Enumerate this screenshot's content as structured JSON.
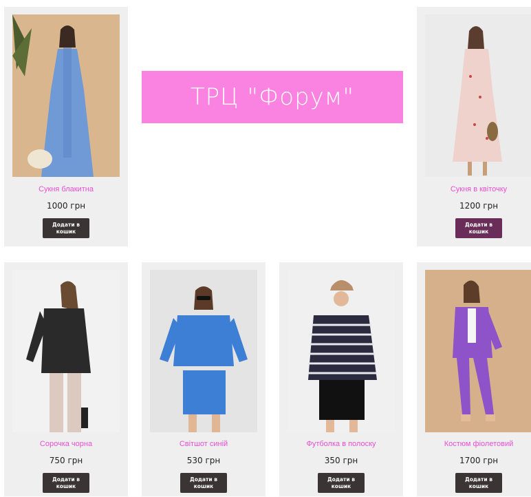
{
  "banner": {
    "text": "ТРЦ \"Форум\""
  },
  "colors": {
    "accent": "#fa82e0",
    "product_name": "#e64fd3",
    "button": "#3b3434",
    "button_active": "#6a2c58"
  },
  "products": [
    {
      "name": "Сукня блакитна",
      "price": "1000 грн",
      "button": "Додати в кошик"
    },
    {
      "name": "Сукня в квіточку",
      "price": "1200 грн",
      "button": "Додати в кошик"
    },
    {
      "name": "Сорочка чорна",
      "price": "750 грн",
      "button": "Додати в кошик"
    },
    {
      "name": "Світшот синій",
      "price": "530 грн",
      "button": "Додати в кошик"
    },
    {
      "name": "Футболка в полоску",
      "price": "350 грн",
      "button": "Додати в кошик"
    },
    {
      "name": "Костюм фіолетовий",
      "price": "1700 грн",
      "button": "Додати в кошик"
    }
  ]
}
